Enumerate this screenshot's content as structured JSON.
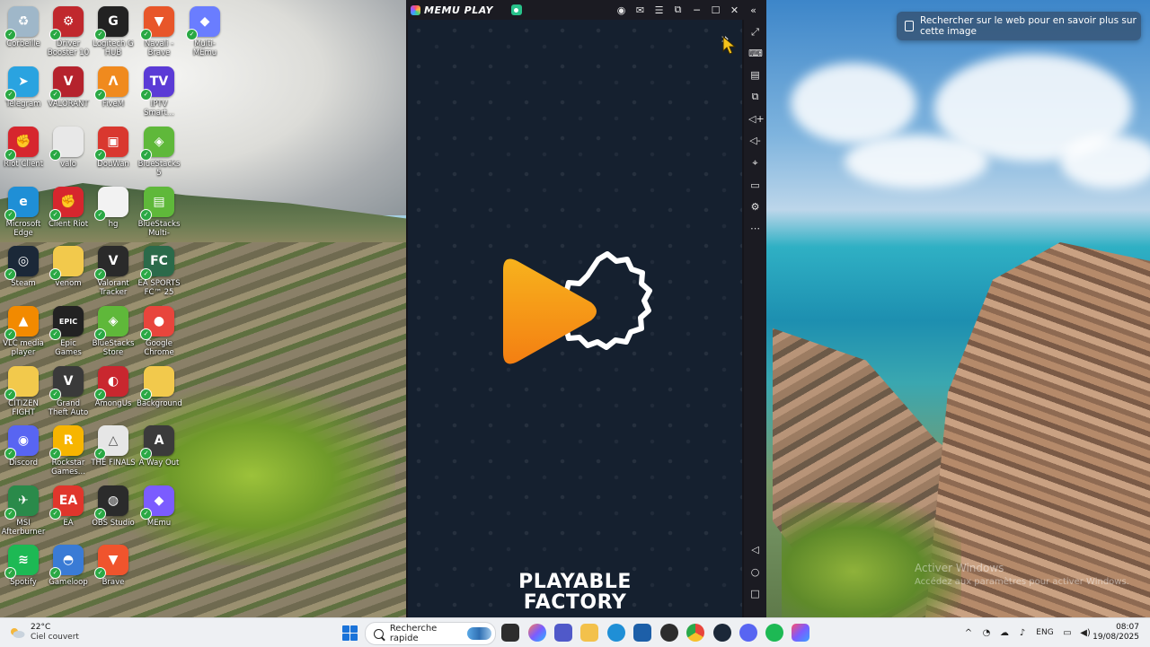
{
  "desktop": {
    "icons": [
      {
        "id": "recycle",
        "label": "Corbeille",
        "color": "#9fb7c9",
        "glyph": "♻"
      },
      {
        "id": "driver-booster",
        "label": "Driver Booster 10",
        "color": "#c0282d",
        "glyph": "⚙"
      },
      {
        "id": "logitech",
        "label": "Logitech G HUB",
        "color": "#222222",
        "glyph": "G"
      },
      {
        "id": "brave-alt",
        "label": "Navali - Brave",
        "color": "#e8562a",
        "glyph": "▼"
      },
      {
        "id": "multi-memu",
        "label": "Multi-MEmu",
        "color": "#6a7dff",
        "glyph": "◆"
      },
      {
        "id": "telegram",
        "label": "Telegram",
        "color": "#2aa3e0",
        "glyph": "➤"
      },
      {
        "id": "valorant",
        "label": "VALORANT",
        "color": "#b5232d",
        "glyph": "V"
      },
      {
        "id": "fivem",
        "label": "FiveM",
        "color": "#f08a1e",
        "glyph": "Λ"
      },
      {
        "id": "iptv",
        "label": "IPTV Smart...",
        "color": "#5b3bd6",
        "glyph": "TV"
      },
      {
        "id": "riot",
        "label": "Riot Client",
        "color": "#d6262e",
        "glyph": "✊"
      },
      {
        "id": "valo-file",
        "label": "valo",
        "color": "#e8e8e8",
        "glyph": ""
      },
      {
        "id": "douwan",
        "label": "DouWan",
        "color": "#d9382f",
        "glyph": "▣"
      },
      {
        "id": "bluestacks5",
        "label": "BlueStacks 5",
        "color": "#5fb83a",
        "glyph": "◈"
      },
      {
        "id": "edge",
        "label": "Microsoft Edge",
        "color": "#1f8fd6",
        "glyph": "e"
      },
      {
        "id": "client-riot",
        "label": "Client Riot",
        "color": "#d6262e",
        "glyph": "✊"
      },
      {
        "id": "hg",
        "label": "hg",
        "color": "#f2f2f2",
        "glyph": ""
      },
      {
        "id": "bluestacks-multi",
        "label": "BlueStacks Multi-Insta...",
        "color": "#5fb83a",
        "glyph": "▤"
      },
      {
        "id": "steam",
        "label": "Steam",
        "color": "#1b2838",
        "glyph": "◎"
      },
      {
        "id": "venom",
        "label": "venom",
        "color": "#f2c94c",
        "glyph": ""
      },
      {
        "id": "valorant-tracker",
        "label": "Valorant Tracker",
        "color": "#2a2a2a",
        "glyph": "V"
      },
      {
        "id": "ea-fc",
        "label": "EA SPORTS FC™ 25",
        "color": "#2b6a4a",
        "glyph": "FC"
      },
      {
        "id": "vlc",
        "label": "VLC media player",
        "color": "#f28a00",
        "glyph": "▲"
      },
      {
        "id": "epic",
        "label": "Epic Games Launcher",
        "color": "#222222",
        "glyph": "EPIC"
      },
      {
        "id": "bluestacks-store",
        "label": "BlueStacks Store",
        "color": "#5fb83a",
        "glyph": "◈"
      },
      {
        "id": "chrome",
        "label": "Google Chrome",
        "color": "#e8453c",
        "glyph": "●"
      },
      {
        "id": "citizen",
        "label": "CITIZEN FIGHT",
        "color": "#f2c94c",
        "glyph": ""
      },
      {
        "id": "gta",
        "label": "Grand Theft Auto V",
        "color": "#3a3a3a",
        "glyph": "V"
      },
      {
        "id": "amongus",
        "label": "AmongUs",
        "color": "#c9272f",
        "glyph": "◐"
      },
      {
        "id": "background",
        "label": "Background",
        "color": "#f2c94c",
        "glyph": ""
      },
      {
        "id": "discord",
        "label": "Discord",
        "color": "#5865f2",
        "glyph": "◉"
      },
      {
        "id": "rockstar",
        "label": "Rockstar Games...",
        "color": "#f7b500",
        "glyph": "R"
      },
      {
        "id": "the-finals",
        "label": "THE FINALS",
        "color": "#e6e6e6",
        "glyph": "△"
      },
      {
        "id": "a-way-out",
        "label": "A Way Out",
        "color": "#3b3b3b",
        "glyph": "A"
      },
      {
        "id": "msi",
        "label": "MSI Afterburner",
        "color": "#2a8a4a",
        "glyph": "✈"
      },
      {
        "id": "ea",
        "label": "EA",
        "color": "#e0362c",
        "glyph": "EA"
      },
      {
        "id": "obs",
        "label": "OBS Studio",
        "color": "#2b2b2b",
        "glyph": "◍"
      },
      {
        "id": "memu",
        "label": "MEmu",
        "color": "#7b5cff",
        "glyph": "◆"
      },
      {
        "id": "spotify",
        "label": "Spotify",
        "color": "#1db954",
        "glyph": "≋"
      },
      {
        "id": "gameloop",
        "label": "Gameloop",
        "color": "#3a7bd5",
        "glyph": "◓"
      },
      {
        "id": "brave",
        "label": "Brave",
        "color": "#f0542d",
        "glyph": "▼"
      }
    ]
  },
  "memu": {
    "brand": "MEMU PLAY",
    "splash": {
      "brand_line1": "PLAYABLE",
      "brand_line2": "FACTORY"
    }
  },
  "lens": {
    "text": "Rechercher sur le web pour en savoir plus sur cette image"
  },
  "watermark": {
    "line1": "Activer Windows",
    "line2": "Accédez aux paramètres pour activer Windows."
  },
  "taskbar": {
    "weather_temp": "22°C",
    "weather_desc": "Ciel couvert",
    "search_placeholder": "Recherche rapide",
    "lang": "ENG",
    "time": "08:07",
    "date": "19/08/2025"
  },
  "colors": {
    "memu_bg": "#15202f",
    "splash_orange": "#f7a21b",
    "taskbar_bg": "#eef0f3"
  }
}
